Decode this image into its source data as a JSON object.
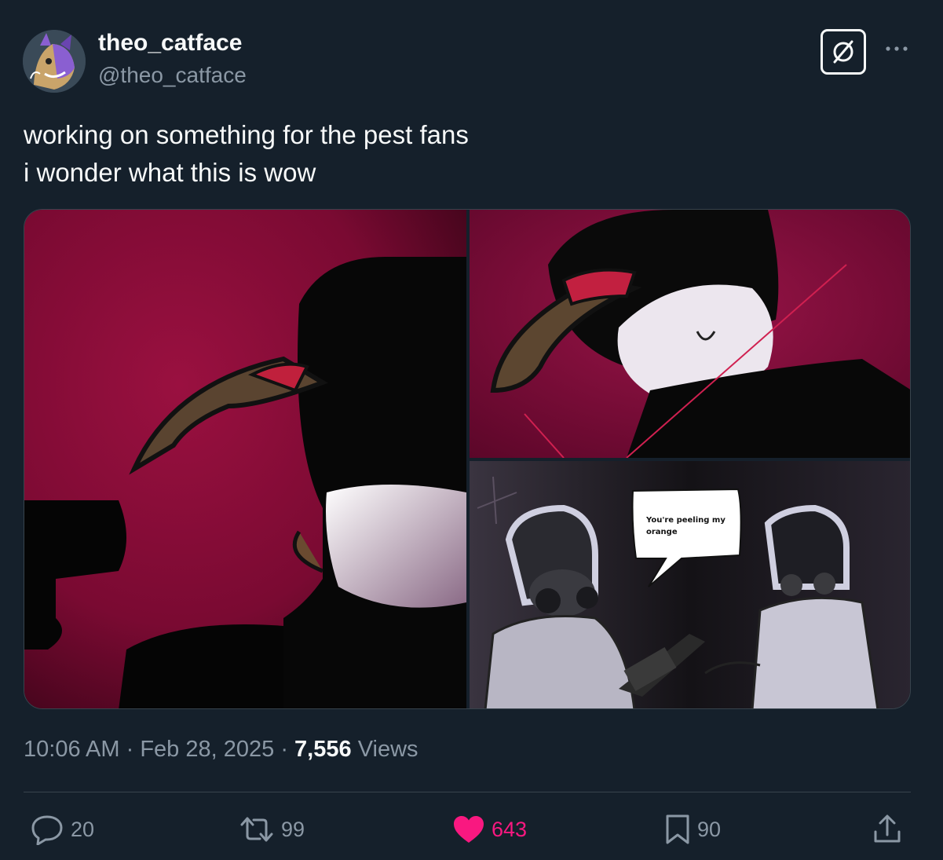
{
  "author": {
    "display_name": "theo_catface",
    "handle": "@theo_catface"
  },
  "post": {
    "text_lines": [
      "working on something for the pest fans",
      "i wonder what this is wow"
    ],
    "speech_bubble": "You're peeling my orange"
  },
  "meta": {
    "time": "10:06 AM",
    "date": "Feb 28, 2025",
    "views_count": "7,556",
    "views_label": "Views",
    "separator": "·"
  },
  "actions": {
    "replies": "20",
    "reposts": "99",
    "likes": "643",
    "bookmarks": "90"
  },
  "colors": {
    "background": "#15202b",
    "secondary_text": "#8b98a5",
    "like_pink": "#f91880",
    "divider": "#38444d"
  },
  "icons": [
    "grok-icon",
    "more-icon",
    "reply-icon",
    "repost-icon",
    "like-icon",
    "bookmark-icon",
    "share-icon"
  ]
}
